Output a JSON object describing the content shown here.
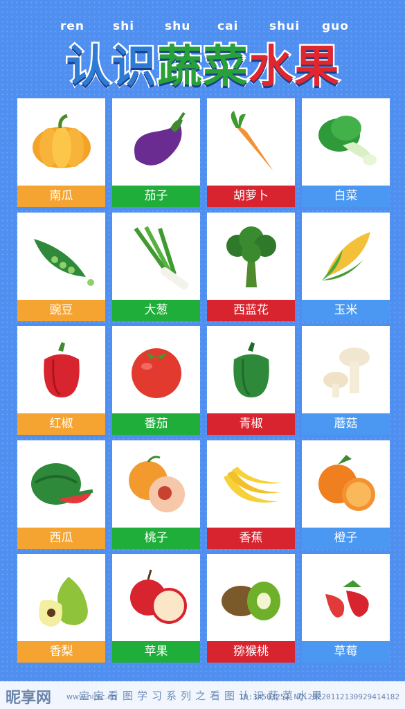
{
  "header": {
    "pinyin": [
      "ren",
      "shi",
      "shu",
      "cai",
      "shui",
      "guo"
    ],
    "title_chars": [
      {
        "char": "认",
        "color": "#2e7bd6"
      },
      {
        "char": "识",
        "color": "#2e7bd6"
      },
      {
        "char": "蔬",
        "color": "#28a238"
      },
      {
        "char": "菜",
        "color": "#28a238"
      },
      {
        "char": "水",
        "color": "#e0262e"
      },
      {
        "char": "果",
        "color": "#e0262e"
      }
    ]
  },
  "label_colors": {
    "orange": "#f5a431",
    "green": "#1fae3a",
    "red": "#d8242f",
    "blue": "#4a98f2"
  },
  "cards": [
    {
      "label": "南瓜",
      "icon": "pumpkin-icon",
      "color": "orange"
    },
    {
      "label": "茄子",
      "icon": "eggplant-icon",
      "color": "green"
    },
    {
      "label": "胡萝卜",
      "icon": "carrot-icon",
      "color": "red"
    },
    {
      "label": "白菜",
      "icon": "bok-choy-icon",
      "color": "blue"
    },
    {
      "label": "豌豆",
      "icon": "pea-pod-icon",
      "color": "orange"
    },
    {
      "label": "大葱",
      "icon": "scallion-icon",
      "color": "green"
    },
    {
      "label": "西蓝花",
      "icon": "broccoli-icon",
      "color": "red"
    },
    {
      "label": "玉米",
      "icon": "corn-icon",
      "color": "blue"
    },
    {
      "label": "红椒",
      "icon": "red-pepper-icon",
      "color": "orange"
    },
    {
      "label": "番茄",
      "icon": "tomato-icon",
      "color": "green"
    },
    {
      "label": "青椒",
      "icon": "green-pepper-icon",
      "color": "red"
    },
    {
      "label": "蘑菇",
      "icon": "mushroom-icon",
      "color": "blue"
    },
    {
      "label": "西瓜",
      "icon": "watermelon-icon",
      "color": "orange"
    },
    {
      "label": "桃子",
      "icon": "peach-icon",
      "color": "green"
    },
    {
      "label": "香蕉",
      "icon": "banana-icon",
      "color": "red"
    },
    {
      "label": "橙子",
      "icon": "orange-icon",
      "color": "blue"
    },
    {
      "label": "香梨",
      "icon": "pear-icon",
      "color": "orange"
    },
    {
      "label": "苹果",
      "icon": "apple-icon",
      "color": "green"
    },
    {
      "label": "猕猴桃",
      "icon": "kiwi-icon",
      "color": "red"
    },
    {
      "label": "草莓",
      "icon": "strawberry-icon",
      "color": "blue"
    }
  ],
  "footer": {
    "caption": "宝宝看图学习系列之看图认识蔬菜水果",
    "watermark_logo": "昵享网",
    "watermark_url": "www.nipic.cn",
    "watermark_id": "ID:34503252 NO:20220112130929414182"
  }
}
